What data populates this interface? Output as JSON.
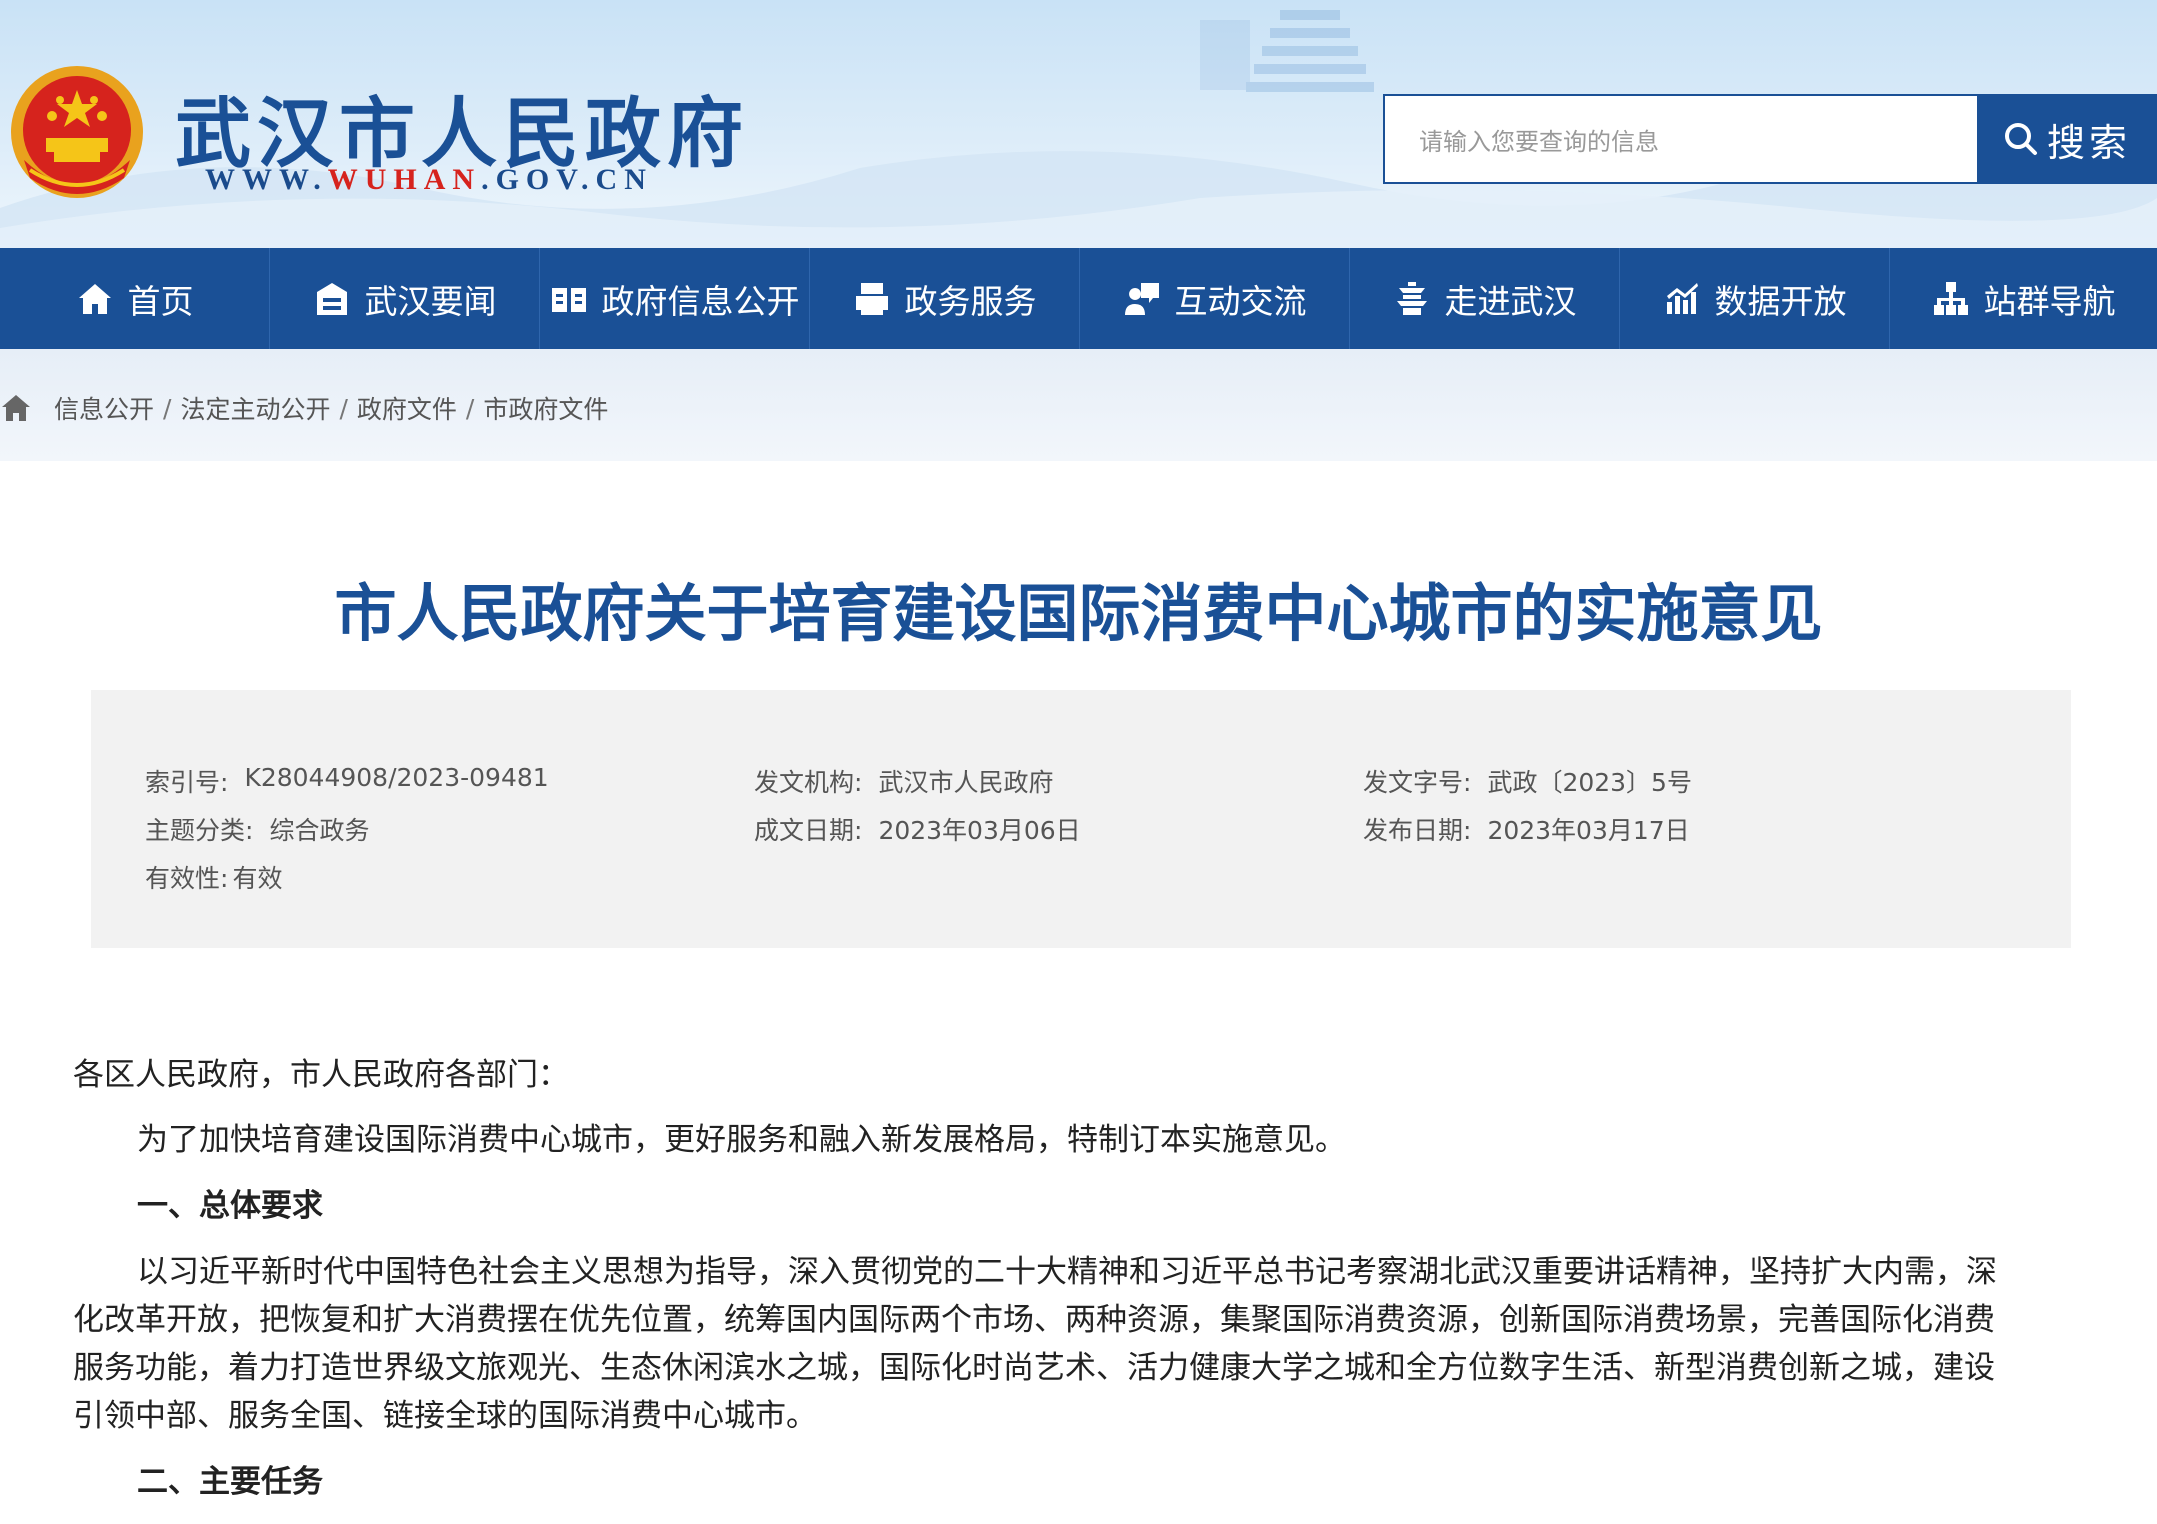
{
  "header": {
    "site_title": "武汉市人民政府",
    "site_url_prefix": "WWW.",
    "site_url_highlight": "WUHAN",
    "site_url_suffix": ".GOV.CN",
    "search_placeholder": "请输入您要查询的信息",
    "search_button": "搜索",
    "accent_color": "#1a5096"
  },
  "nav": {
    "items": [
      {
        "label": "首页",
        "icon": "home-icon"
      },
      {
        "label": "武汉要闻",
        "icon": "news-icon"
      },
      {
        "label": "政府信息公开",
        "icon": "book-icon"
      },
      {
        "label": "政务服务",
        "icon": "printer-icon"
      },
      {
        "label": "互动交流",
        "icon": "chat-icon"
      },
      {
        "label": "走进武汉",
        "icon": "tower-icon"
      },
      {
        "label": "数据开放",
        "icon": "chart-icon"
      },
      {
        "label": "站群导航",
        "icon": "sitemap-icon"
      }
    ]
  },
  "breadcrumb": {
    "items": [
      "信息公开",
      "法定主动公开",
      "政府文件",
      "市政府文件"
    ],
    "separator": "/"
  },
  "document": {
    "title": "市人民政府关于培育建设国际消费中心城市的实施意见",
    "meta": {
      "index_label": "索引号:",
      "index_value": "K28044908/2023-09481",
      "issuer_label": "发文机构:",
      "issuer_value": "武汉市人民政府",
      "docno_label": "发文字号:",
      "docno_value": "武政〔2023〕5号",
      "topic_label": "主题分类:",
      "topic_value": "综合政务",
      "created_label": "成文日期:",
      "created_value": "2023年03月06日",
      "published_label": "发布日期:",
      "published_value": "2023年03月17日",
      "validity_label": "有效性:",
      "validity_value": "有效"
    },
    "salutation": "各区人民政府，市人民政府各部门：",
    "intro": "为了加快培育建设国际消费中心城市，更好服务和融入新发展格局，特制订本实施意见。",
    "section1_heading": "一、总体要求",
    "section1_line1": "以习近平新时代中国特色社会主义思想为指导，深入贯彻党的二十大精神和习近平总书记考察湖北武汉重要讲话精神，坚持扩大内需，深",
    "section1_line2": "化改革开放，把恢复和扩大消费摆在优先位置，统筹国内国际两个市场、两种资源，集聚国际消费资源，创新国际消费场景，完善国际化消费",
    "section1_line3": "服务功能，着力打造世界级文旅观光、生态休闲滨水之城，国际化时尚艺术、活力健康大学之城和全方位数字生活、新型消费创新之城，建设",
    "section1_line4": "引领中部、服务全国、链接全球的国际消费中心城市。",
    "section2_heading": "二、主要任务"
  }
}
